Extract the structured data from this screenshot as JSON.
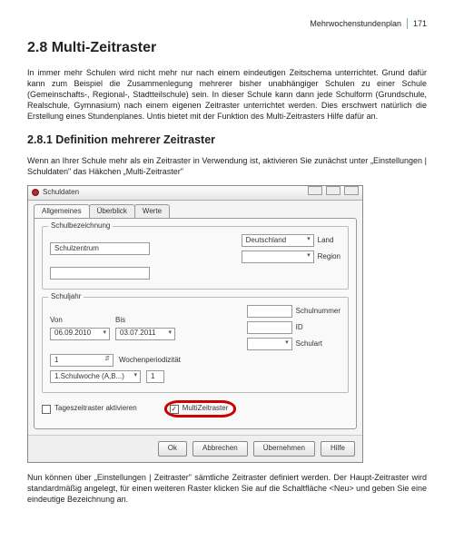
{
  "header": {
    "running": "Mehrwochenstundenplan",
    "pageno": "171"
  },
  "headings": {
    "h1": "2.8    Multi-Zeitraster",
    "h2": "2.8.1 Definition mehrerer Zeitraster"
  },
  "paras": {
    "p1": "In immer mehr Schulen wird nicht mehr nur nach einem eindeutigen Zeitschema unterrichtet. Grund dafür kann zum Beispiel die Zusammenlegung mehrerer bisher unabhängiger Schulen zu einer Schule (Gemeinschafts-, Regional-, Stadtteilschule) sein. In dieser Schule kann dann jede Schulform (Grundschule, Realschule, Gymnasium) nach einem eigenen Zeitraster unterrichtet werden. Dies erschwert natürlich die Erstellung eines Stundenplanes. Untis bietet mit der Funktion des Multi-Zeitrasters Hilfe dafür an.",
    "p2": "Wenn an Ihrer Schule mehr als ein Zeitraster in Verwendung ist, aktivieren Sie zunächst unter „Einstellungen | Schuldaten\" das Häkchen „Multi-Zeitraster\"",
    "p3": "Nun können über „Einstellungen | Zeitraster\" sämtliche Zeitraster definiert werden. Der Haupt-Zeitraster wird standardmäßig angelegt, für einen weiteren Raster klicken Sie auf die Schaltfläche <Neu> und geben Sie eine eindeutige Bezeichnung an."
  },
  "dialog": {
    "title": "Schuldaten",
    "tabs": {
      "t1": "Allgemeines",
      "t2": "Überblick",
      "t3": "Werte"
    },
    "group1": {
      "legend": "Schulbezeichnung",
      "name": "Schulzentrum",
      "countryLabel": "Land",
      "country": "Deutschland",
      "regionLabel": "Region"
    },
    "group2": {
      "legend": "Schuljahr",
      "vonLabel": "Von",
      "bisLabel": "Bis",
      "von": "06.09.2010",
      "bis": "03.07.2011",
      "weekperiod": "1",
      "weekperiodLabel": "Wochenperiodizität",
      "weekA": "1.Schulwoche (A,B...)",
      "weekAval": "1",
      "schulnrLabel": "Schulnummer",
      "idLabel": "ID",
      "schulartLabel": "Schulart"
    },
    "checks": {
      "dayraster": "Tageszeitraster aktivieren",
      "multiraster": "MultiZeitraster"
    },
    "buttons": {
      "ok": "Ok",
      "cancel": "Abbrechen",
      "apply": "Übernehmen",
      "help": "Hilfe"
    }
  }
}
